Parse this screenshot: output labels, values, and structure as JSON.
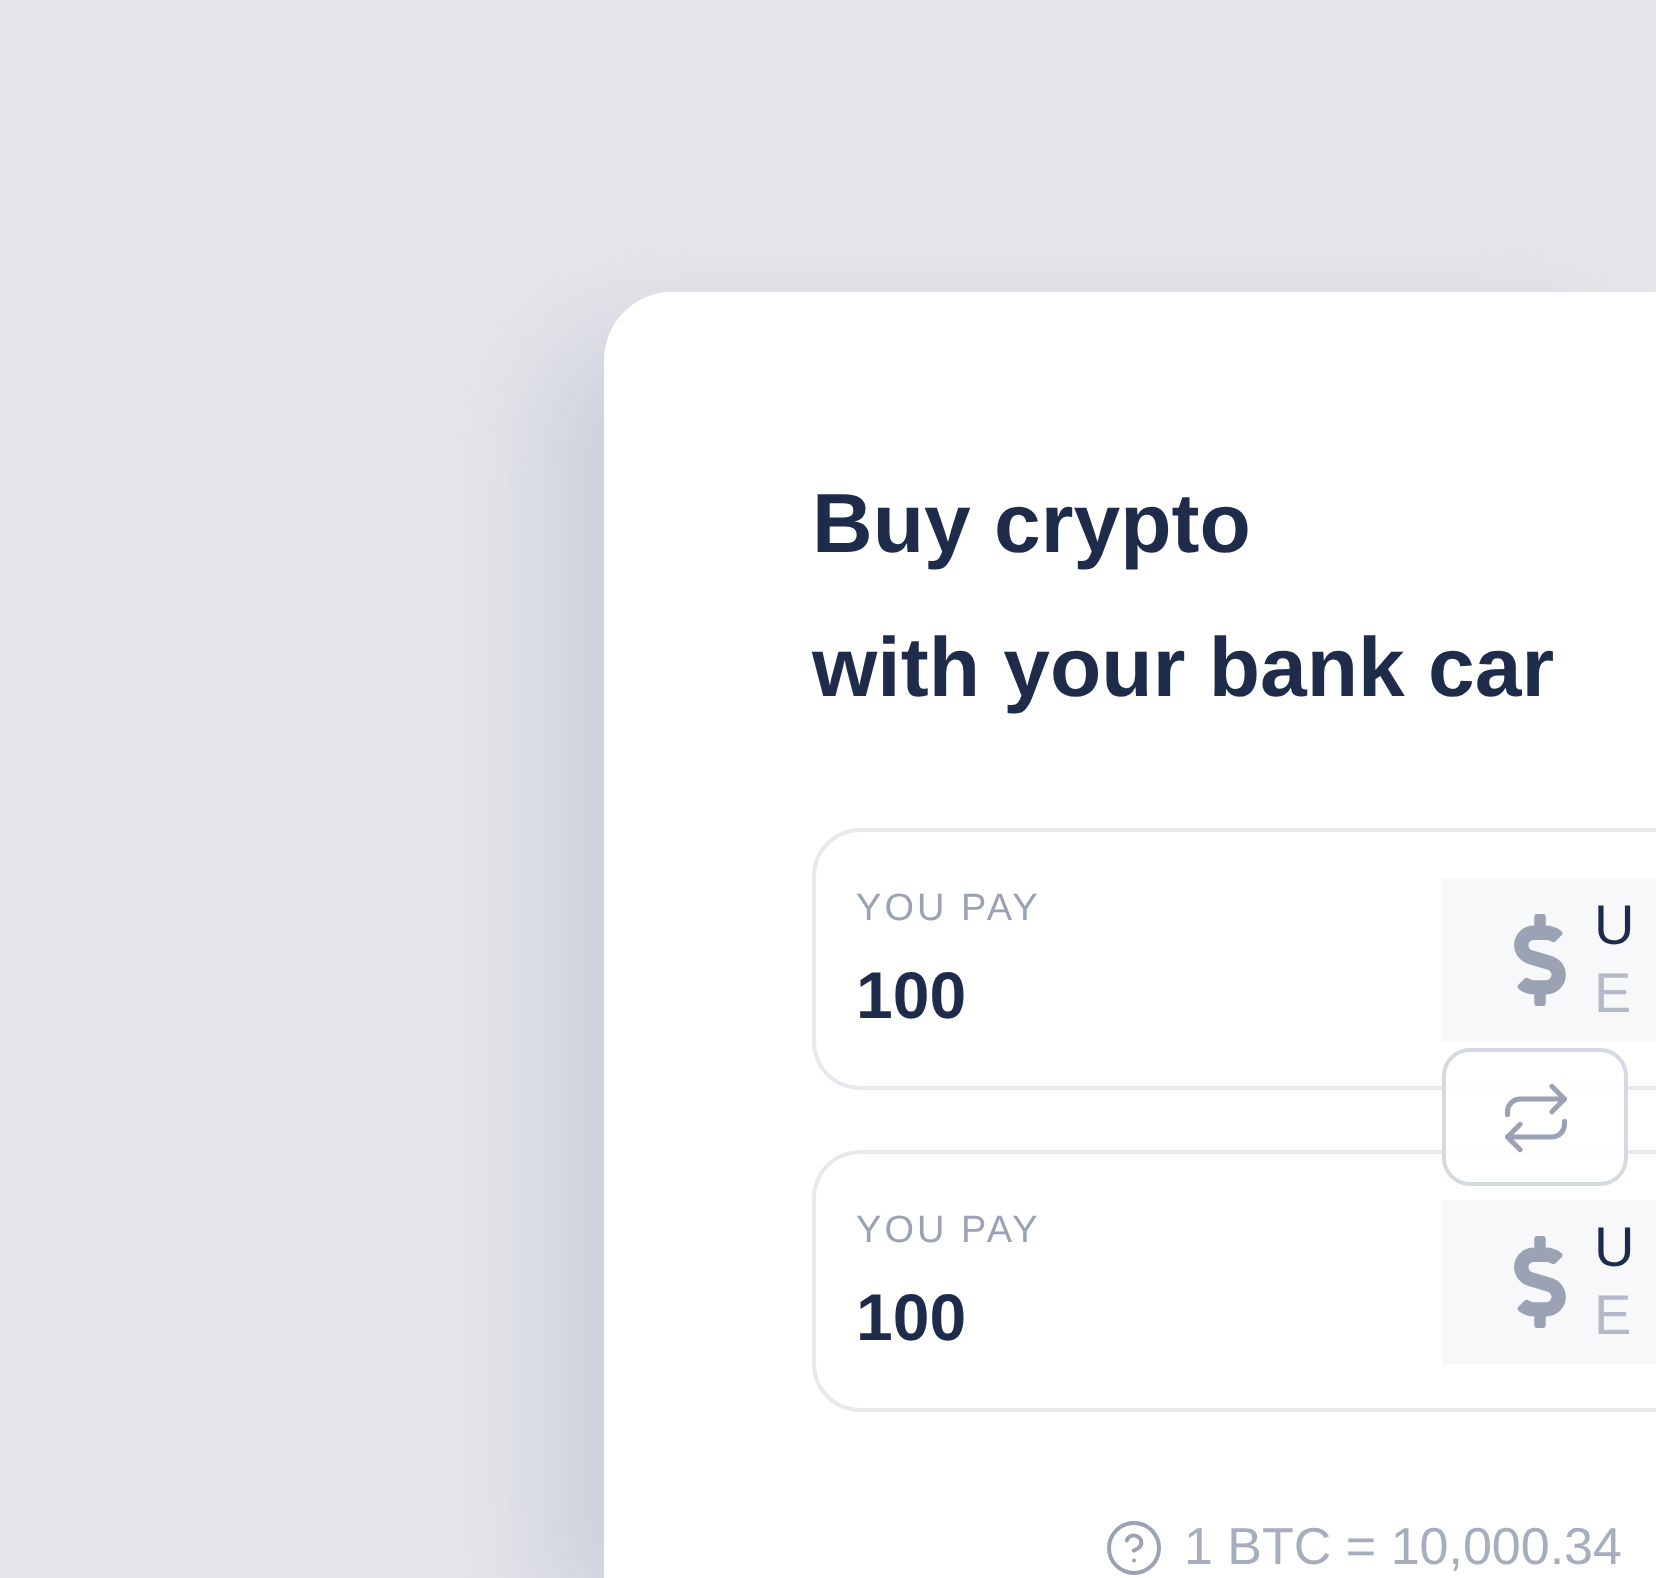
{
  "title_lines": [
    "Buy crypto",
    "with your bank car"
  ],
  "fields": [
    {
      "label": "YOU PAY",
      "value": "100",
      "currency_code": "U",
      "currency_name": "E"
    },
    {
      "label": "YOU PAY",
      "value": "100",
      "currency_code": "U",
      "currency_name": "E"
    }
  ],
  "rate": "1 BTC = 10,000.34"
}
